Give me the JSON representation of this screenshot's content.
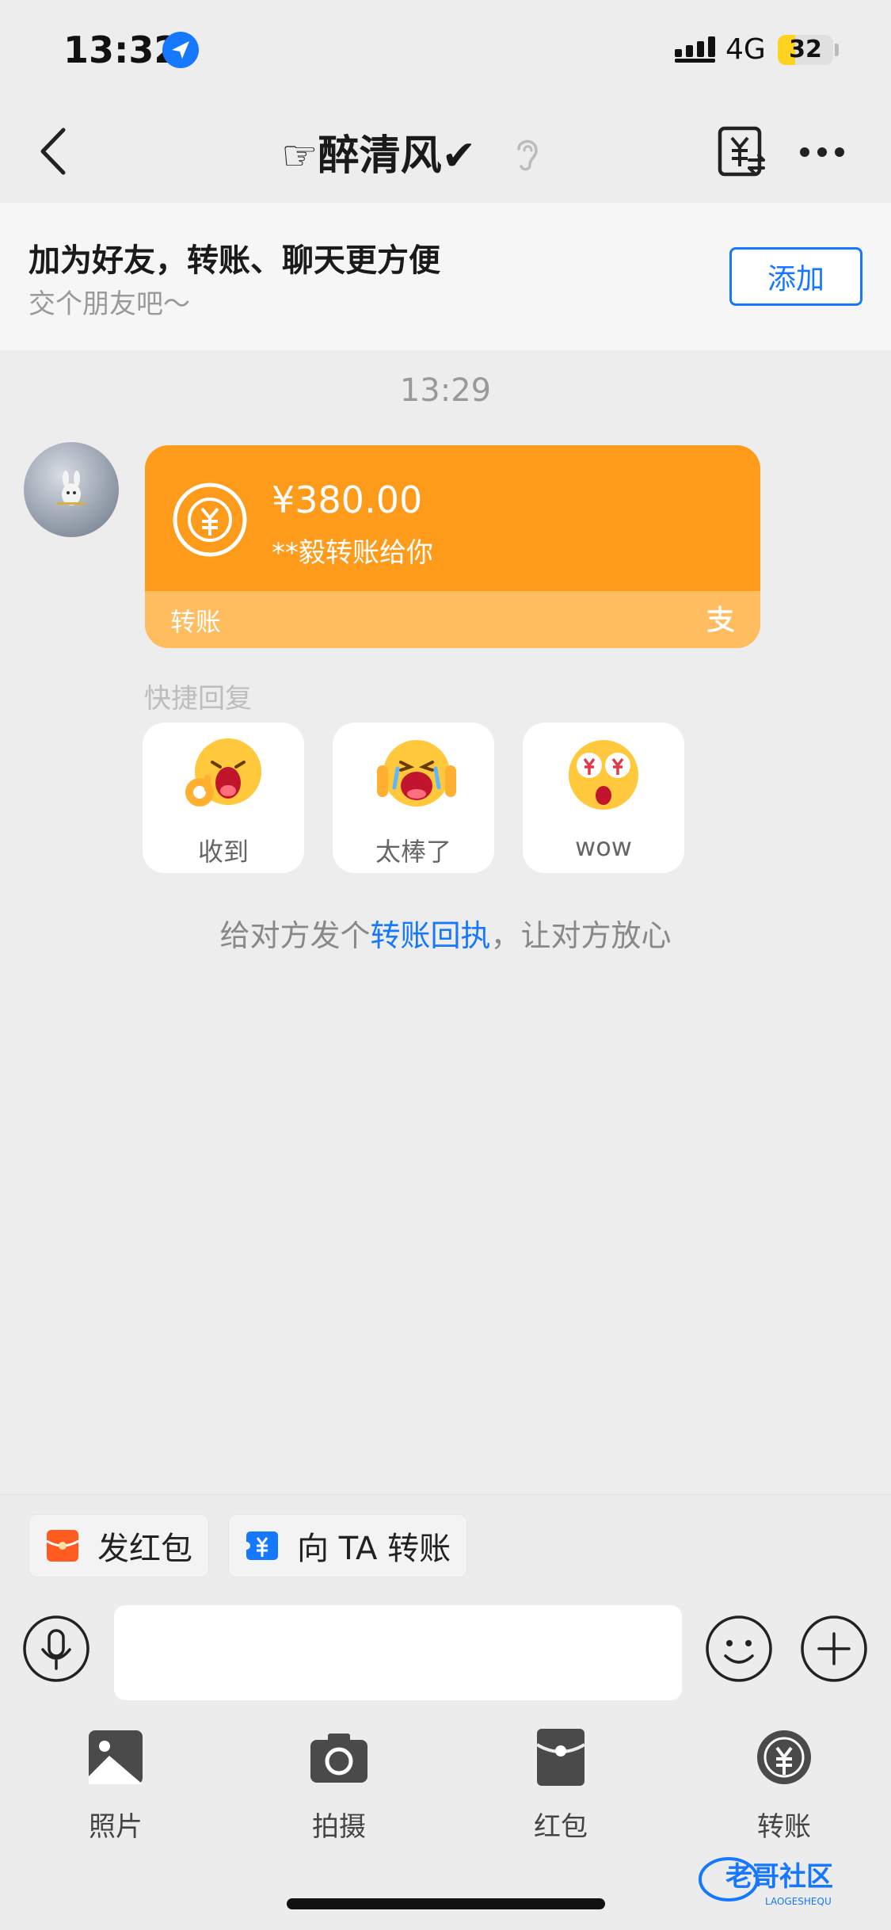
{
  "status_bar": {
    "time": "13:32",
    "network": "4G",
    "battery": "32",
    "battery_level": 0.32,
    "icons": [
      "location-arrow-icon",
      "signal-icon",
      "battery-icon"
    ]
  },
  "nav": {
    "title": "☞醉清风✔",
    "icons": [
      "back-icon",
      "ear-icon",
      "transfer-doc-icon",
      "more-icon"
    ]
  },
  "friend_banner": {
    "title": "加为好友，转账、聊天更方便",
    "subtitle": "交个朋友吧～",
    "add_label": "添加"
  },
  "chat": {
    "time": "13:29",
    "transfer": {
      "amount": "¥380.00",
      "note": "**毅转账给你",
      "label": "转账"
    },
    "quick_reply": {
      "label": "快捷回复",
      "items": [
        {
          "text": "收到",
          "icon": "ok-hand-emoji-icon"
        },
        {
          "text": "太棒了",
          "icon": "thumbs-up-emoji-icon"
        },
        {
          "text": "wow",
          "icon": "money-eyes-emoji-icon"
        }
      ]
    },
    "receipt_tip": {
      "prefix": "给对方发个",
      "link": "转账回执",
      "suffix": "，让对方放心"
    }
  },
  "shortcuts": {
    "red_packet": "发红包",
    "transfer_to": "向 TA 转账"
  },
  "input": {
    "placeholder": ""
  },
  "panel": {
    "items": [
      {
        "label": "照片",
        "icon": "photo-icon"
      },
      {
        "label": "拍摄",
        "icon": "camera-icon"
      },
      {
        "label": "红包",
        "icon": "red-packet-icon"
      },
      {
        "label": "转账",
        "icon": "transfer-icon"
      }
    ]
  },
  "watermark": {
    "text": "老哥社区",
    "sub": "LAOGESHEQU"
  },
  "colors": {
    "accent": "#1677ff",
    "transfer_orange": "#ff9b1a",
    "transfer_bottom": "#ffbd5f",
    "background": "#ededed"
  }
}
